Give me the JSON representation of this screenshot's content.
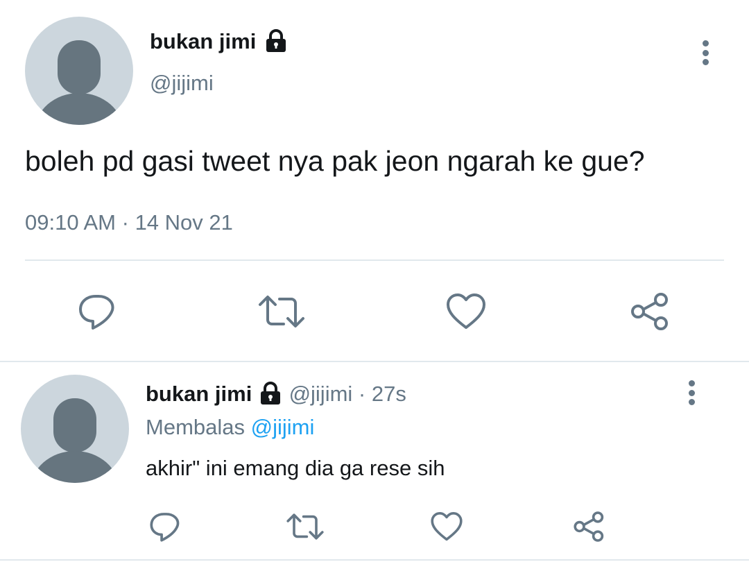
{
  "main_tweet": {
    "display_name": "bukan jimi",
    "handle": "@jijimi",
    "text": "boleh pd gasi tweet nya pak jeon ngarah ke gue?",
    "time": "09:10 AM",
    "separator": "·",
    "date": "14 Nov 21",
    "actions": [
      "reply-icon",
      "retweet-icon",
      "like-icon",
      "share-icon"
    ]
  },
  "reply_tweet": {
    "display_name": "bukan jimi",
    "handle": "@jijimi",
    "separator": "·",
    "age": "27s",
    "replying_label": "Membalas",
    "replying_to": "@jijimi",
    "text": "akhir\" ini emang dia ga rese sih",
    "actions": [
      "reply-icon",
      "retweet-icon",
      "like-icon",
      "share-icon"
    ]
  },
  "colors": {
    "text": "#14171a",
    "secondary": "#657786",
    "link": "#1da1f2",
    "avatar_bg": "#ccd6dd",
    "avatar_fg": "#66757f",
    "divider": "#e1e8ed"
  }
}
